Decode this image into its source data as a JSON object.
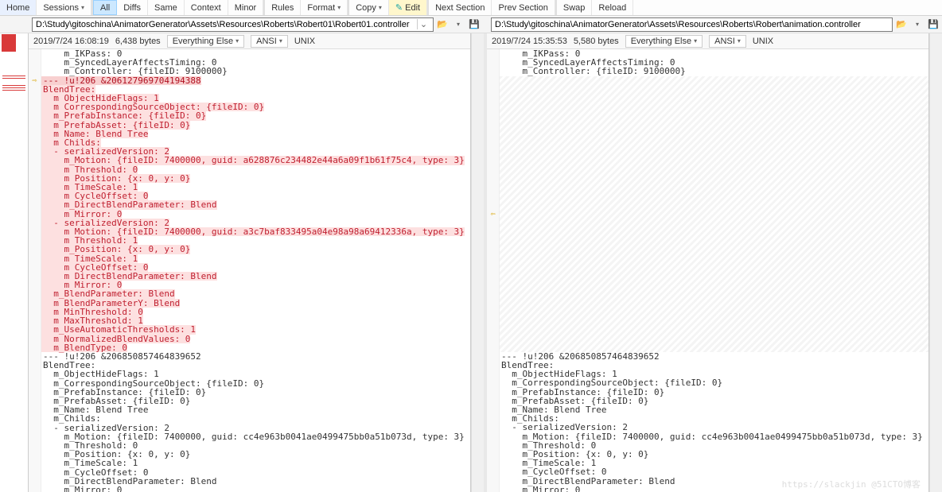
{
  "toolbar": {
    "home": "Home",
    "sessions": "Sessions",
    "all": "All",
    "diffs": "Diffs",
    "same": "Same",
    "context": "Context",
    "minor": "Minor",
    "rules": "Rules",
    "format": "Format",
    "copy": "Copy",
    "edit": "Edit",
    "next": "Next Section",
    "prev": "Prev Section",
    "swap": "Swap",
    "reload": "Reload"
  },
  "left": {
    "path": "D:\\Study\\gitoschina\\AnimatorGenerator\\Assets\\Resources\\Roberts\\Robert01\\Robert01.controller",
    "date": "2019/7/24 16:08:19",
    "size": "6,438 bytes",
    "enc": "Everything Else",
    "charset": "ANSI",
    "eol": "UNIX"
  },
  "right": {
    "path": "D:\\Study\\gitoschina\\AnimatorGenerator\\Assets\\Resources\\Roberts\\Robert\\animation.controller",
    "date": "2019/7/24 15:35:53",
    "size": "5,580 bytes",
    "enc": "Everything Else",
    "charset": "ANSI",
    "eol": "UNIX"
  },
  "common_head": [
    "    m_IKPass: 0",
    "    m_SyncedLayerAffectsTiming: 0",
    "    m_Controller: {fileID: 9100000}"
  ],
  "left_red_head": "--- !u!206 &206127969704194388",
  "left_red": [
    "BlendTree:",
    "  m_ObjectHideFlags: 1",
    "  m_CorrespondingSourceObject: {fileID: 0}",
    "  m_PrefabInstance: {fileID: 0}",
    "  m_PrefabAsset: {fileID: 0}",
    "  m_Name: Blend Tree",
    "  m_Childs:",
    "  - serializedVersion: 2",
    "    m_Motion: {fileID: 7400000, guid: a628876c234482e44a6a09f1b61f75c4, type: 3}",
    "    m_Threshold: 0",
    "    m_Position: {x: 0, y: 0}",
    "    m_TimeScale: 1",
    "    m_CycleOffset: 0",
    "    m_DirectBlendParameter: Blend",
    "    m_Mirror: 0",
    "  - serializedVersion: 2",
    "    m_Motion: {fileID: 7400000, guid: a3c7baf833495a04e98a98a69412336a, type: 3}",
    "    m_Threshold: 1",
    "    m_Position: {x: 0, y: 0}",
    "    m_TimeScale: 1",
    "    m_CycleOffset: 0",
    "    m_DirectBlendParameter: Blend",
    "    m_Mirror: 0",
    "  m_BlendParameter: Blend",
    "  m_BlendParameterY: Blend",
    "  m_MinThreshold: 0",
    "  m_MaxThreshold: 1",
    "  m_UseAutomaticThresholds: 1",
    "  m_NormalizedBlendValues: 0",
    "  m_BlendType: 0"
  ],
  "common_tail": [
    "--- !u!206 &206850857464839652",
    "BlendTree:",
    "  m_ObjectHideFlags: 1",
    "  m_CorrespondingSourceObject: {fileID: 0}",
    "  m_PrefabInstance: {fileID: 0}",
    "  m_PrefabAsset: {fileID: 0}",
    "  m_Name: Blend Tree",
    "  m_Childs:",
    "  - serializedVersion: 2",
    "    m_Motion: {fileID: 7400000, guid: cc4e963b0041ae0499475bb0a51b073d, type: 3}",
    "    m_Threshold: 0",
    "    m_Position: {x: 0, y: 0}",
    "    m_TimeScale: 1",
    "    m_CycleOffset: 0",
    "    m_DirectBlendParameter: Blend",
    "    m_Mirror: 0"
  ],
  "watermark": "https://slackjin  @51CTO博客"
}
